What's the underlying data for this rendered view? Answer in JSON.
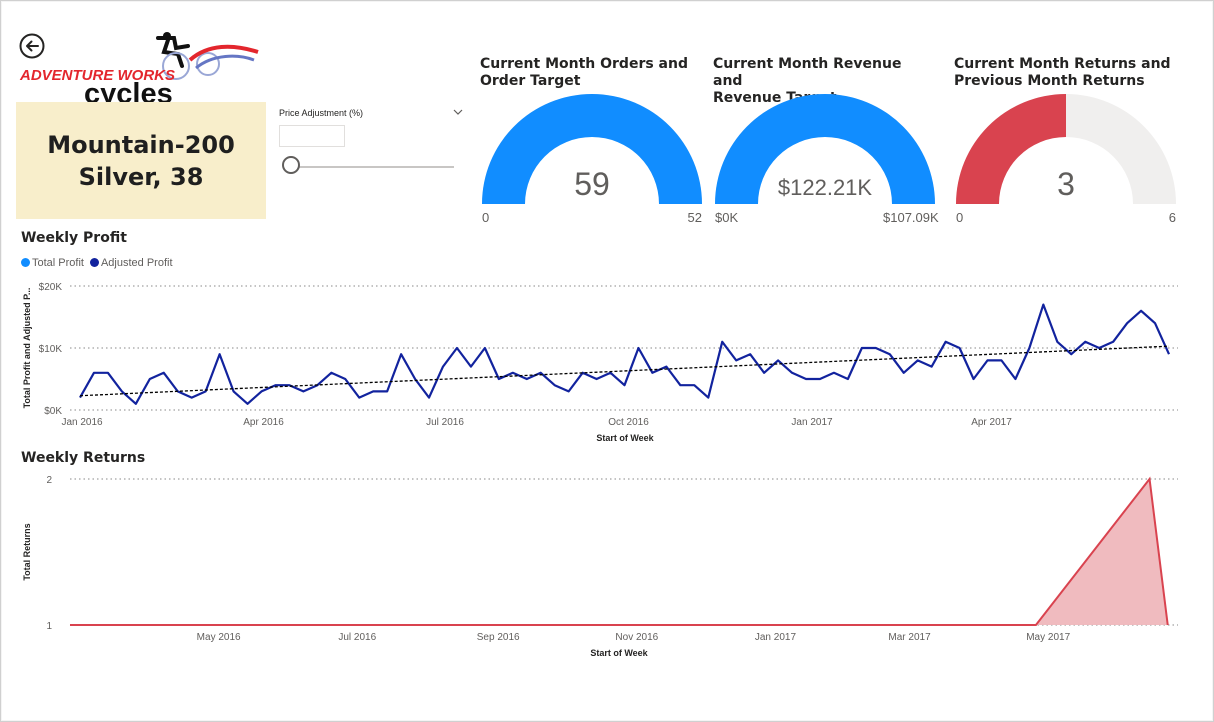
{
  "colors": {
    "gauge_fill": "#118dff",
    "gauge_bg": "#f0efee",
    "returns_fill": "#d9434f",
    "total_profit": "#118dff",
    "adjusted_profit": "#12239e",
    "trend": "#000000",
    "returns_area": "#efb7bc",
    "card_bg": "#f8eecb"
  },
  "logo": {
    "line1": "ADVENTURE WORKS",
    "line2": "cycles"
  },
  "product": {
    "line1": "Mountain-200",
    "line2": "Silver, 38"
  },
  "slicer": {
    "title": "Price Adjustment (%)",
    "value": "",
    "slider_fraction": 0
  },
  "gauges": [
    {
      "title_l1": "Current Month Orders and",
      "title_l2": "Order Target",
      "value": 59,
      "display": "59",
      "min": "0",
      "max": "52",
      "max_num": 52,
      "color": "#118dff"
    },
    {
      "title_l1": "Current Month Revenue and",
      "title_l2": "Revenue Target",
      "value": 122.21,
      "display": "$122.21K",
      "min": "$0K",
      "max": "$107.09K",
      "max_num": 107.09,
      "color": "#118dff"
    },
    {
      "title_l1": "Current Month Returns and",
      "title_l2": "Previous Month Returns",
      "value": 3,
      "display": "3",
      "min": "0",
      "max": "6",
      "max_num": 6,
      "color": "#d9434f"
    }
  ],
  "profit_section": {
    "title": "Weekly Profit",
    "legend": [
      "Total Profit",
      "Adjusted Profit"
    ]
  },
  "returns_section": {
    "title": "Weekly Returns"
  },
  "chart_data": [
    {
      "type": "line",
      "title": "Weekly Profit",
      "xlabel": "Start of Week",
      "ylabel": "Total Profit and Adjusted P...",
      "ylim": [
        0,
        20000
      ],
      "y_ticks": [
        "$0K",
        "$10K",
        "$20K"
      ],
      "x_ticks": [
        "Jan 2016",
        "Apr 2016",
        "Jul 2016",
        "Oct 2016",
        "Jan 2017",
        "Apr 2017"
      ],
      "x_start": "2016-01-04",
      "x_step_days": 7,
      "grid": true,
      "legend_position": "top-left",
      "series": [
        {
          "name": "Adjusted Profit",
          "values": [
            2000,
            6000,
            6000,
            3000,
            1000,
            5000,
            6000,
            3000,
            2000,
            3000,
            9000,
            3000,
            1000,
            3000,
            4000,
            4000,
            3000,
            4000,
            6000,
            5000,
            2000,
            3000,
            3000,
            9000,
            5000,
            2000,
            7000,
            10000,
            7000,
            10000,
            5000,
            6000,
            5000,
            6000,
            4000,
            3000,
            6000,
            5000,
            6000,
            4000,
            10000,
            6000,
            7000,
            4000,
            4000,
            2000,
            11000,
            8000,
            9000,
            6000,
            8000,
            6000,
            5000,
            5000,
            6000,
            5000,
            10000,
            10000,
            9000,
            6000,
            8000,
            7000,
            11000,
            10000,
            5000,
            8000,
            8000,
            5000,
            10000,
            17000,
            11000,
            9000,
            11000,
            10000,
            11000,
            14000,
            16000,
            14000,
            9000
          ]
        },
        {
          "name": "trend",
          "values": [
            2300,
            10300
          ]
        }
      ]
    },
    {
      "type": "area",
      "title": "Weekly Returns",
      "xlabel": "Start of Week",
      "ylabel": "Total Returns",
      "ylim": [
        1,
        2
      ],
      "y_ticks": [
        "1",
        "2"
      ],
      "x_ticks": [
        "May 2016",
        "Jul 2016",
        "Sep 2016",
        "Nov 2016",
        "Jan 2017",
        "Mar 2017",
        "May 2017"
      ],
      "grid": true,
      "series": [
        {
          "name": "Total Returns",
          "x": [
            "2016-03-01",
            "2017-04-30",
            "2017-06-19",
            "2017-06-27"
          ],
          "values": [
            1,
            1,
            2,
            1
          ]
        }
      ]
    }
  ]
}
